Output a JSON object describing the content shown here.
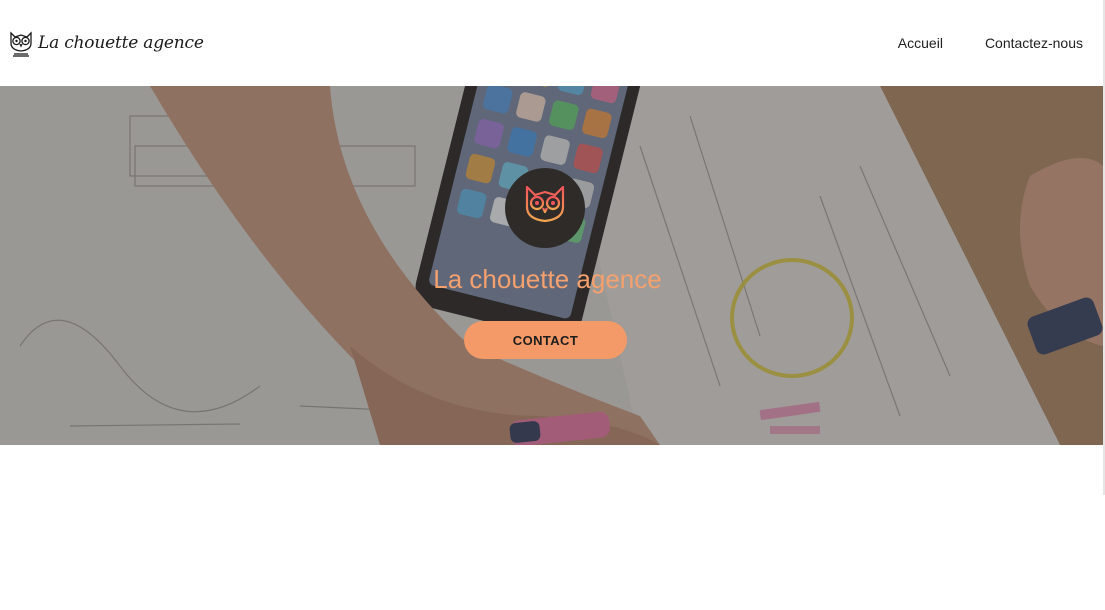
{
  "header": {
    "brand_name": "La chouette agence",
    "nav": [
      {
        "label": "Accueil"
      },
      {
        "label": "Contactez-nous"
      }
    ]
  },
  "hero": {
    "title": "La chouette agence",
    "cta_label": "CONTACT",
    "logo_icon": "owl-icon",
    "background": "photo-hands-phone-sketches"
  },
  "colors": {
    "accent": "#f39a68",
    "title": "#f4a06f",
    "logo_bg": "#2e2b29"
  }
}
